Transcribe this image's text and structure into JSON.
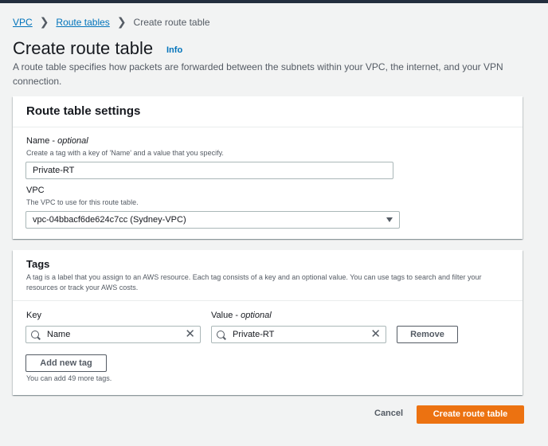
{
  "breadcrumb": {
    "items": [
      {
        "label": "VPC"
      },
      {
        "label": "Route tables"
      },
      {
        "label": "Create route table"
      }
    ],
    "separator": "❯"
  },
  "page": {
    "title": "Create route table",
    "info": "Info",
    "description": "A route table specifies how packets are forwarded between the subnets within your VPC, the internet, and your VPN connection."
  },
  "settings": {
    "header": "Route table settings",
    "name_label": "Name",
    "name_optional": "optional",
    "name_desc": "Create a tag with a key of 'Name' and a value that you specify.",
    "name_value": "Private-RT",
    "vpc_label": "VPC",
    "vpc_desc": "The VPC to use for this route table.",
    "vpc_value": "vpc-04bbacf6de624c7cc (Sydney-VPC)"
  },
  "tags": {
    "title": "Tags",
    "description": "A tag is a label that you assign to an AWS resource. Each tag consists of a key and an optional value. You can use tags to search and filter your resources or track your AWS costs.",
    "key_label": "Key",
    "value_label": "Value",
    "value_optional": "optional",
    "rows": [
      {
        "key": "Name",
        "value": "Private-RT",
        "remove": "Remove"
      }
    ],
    "add_button": "Add new tag",
    "helper": "You can add 49 more tags."
  },
  "footer": {
    "cancel": "Cancel",
    "submit": "Create route table"
  },
  "colors": {
    "link": "#0073bb",
    "primary": "#ec7211",
    "text": "#16191f",
    "secondary_text": "#545b64",
    "background": "#f2f3f3"
  },
  "icons": [
    "search-icon",
    "close-icon",
    "caret-down-icon",
    "chevron-right-icon"
  ]
}
